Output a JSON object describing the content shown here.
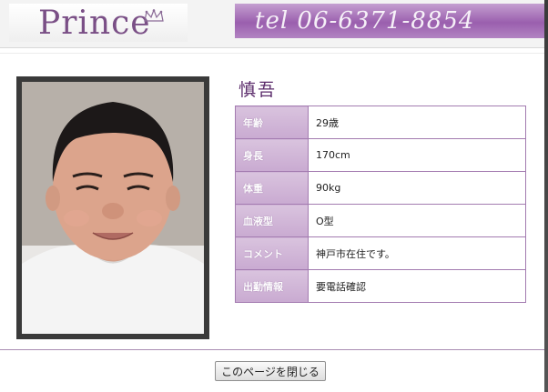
{
  "header": {
    "logo_text": "Prince",
    "tel_text": "tel 06-6371-8854"
  },
  "colors": {
    "accent": "#9a5fae",
    "table_border": "#a37bb0",
    "label_bg": "#d2b6d8",
    "name_color": "#5a2a6a"
  },
  "profile": {
    "name": "慎吾",
    "rows": [
      {
        "label": "年齢",
        "value": "29歳"
      },
      {
        "label": "身長",
        "value": "170cm"
      },
      {
        "label": "体重",
        "value": "90kg"
      },
      {
        "label": "血液型",
        "value": "O型"
      },
      {
        "label": "コメント",
        "value": "神戸市在住です。"
      },
      {
        "label": "出勤情報",
        "value": "要電話確認"
      }
    ]
  },
  "footer": {
    "close_button_label": "このページを閉じる"
  }
}
